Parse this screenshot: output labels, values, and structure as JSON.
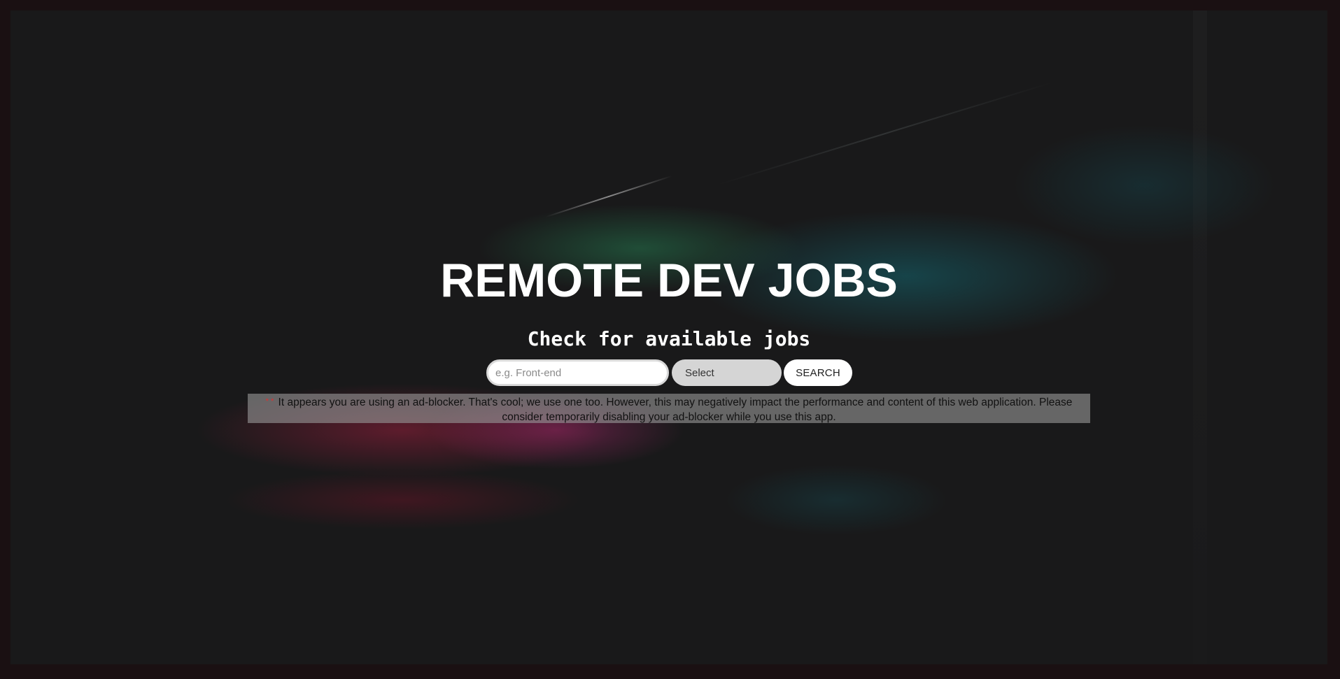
{
  "hero": {
    "title": "REMOTE DEV JOBS",
    "subtitle": "Check for available jobs"
  },
  "search": {
    "input_value": "",
    "input_placeholder": "e.g. Front-end",
    "select_value": "Select",
    "button_label": "SEARCH"
  },
  "notice": {
    "marker": "* *",
    "text": "It appears you are using an ad-blocker. That's cool; we use one too. However, this may negatively impact the performance and content of this web application. Please consider temporarily disabling your ad-blocker while you use this app."
  },
  "colors": {
    "page_background": "#19191a",
    "frame": "#1a1012",
    "title_text": "#ffffff",
    "select_background": "#d5d5d5",
    "notice_background": "#969696",
    "notice_marker": "#e03030"
  },
  "icons": []
}
